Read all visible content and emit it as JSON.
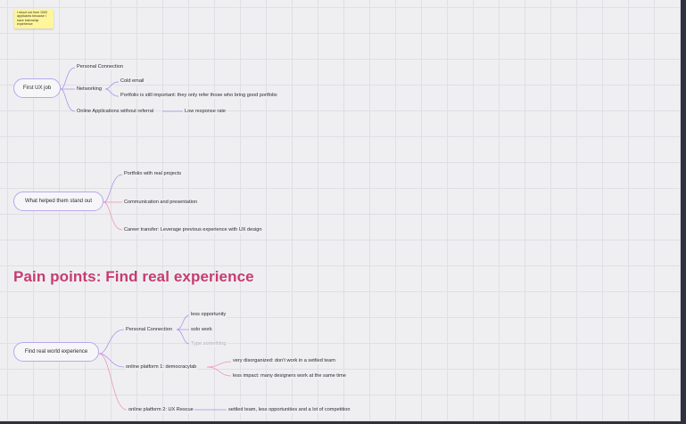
{
  "sticky_note": {
    "text": "I stood out from 1000 applicants because I have internship experience"
  },
  "section_title": "Pain points: Find real experience",
  "colors": {
    "canvas": "#efeff1",
    "grid": "#dfdfe4",
    "title_accent": "#c73c72",
    "connector_purple": "#a98be8",
    "connector_pink": "#ee8fb4",
    "sticky_yellow": "#fff59a"
  },
  "mindmaps": [
    {
      "root": "First UX job",
      "children": [
        {
          "label": "Personal Connection",
          "children": []
        },
        {
          "label": "Networking",
          "children": [
            {
              "label": "Cold email"
            },
            {
              "label": "Portfolio is still important: they only refer those who bring good portfolio"
            }
          ]
        },
        {
          "label": "Online Applications without referral",
          "children": [
            {
              "label": "Low response rate"
            }
          ]
        }
      ]
    },
    {
      "root": "What helped them stand out",
      "children": [
        {
          "label": "Portfolio with real projects"
        },
        {
          "label": "Communication and presentation"
        },
        {
          "label": "Career transfer: Leverage previous experience with UX design"
        }
      ]
    },
    {
      "root": "Find real world experience",
      "children": [
        {
          "label": "Personal Connection",
          "children": [
            {
              "label": "less opportunity"
            },
            {
              "label": "solo work"
            },
            {
              "label": "Type something"
            }
          ]
        },
        {
          "label": "online platform 1:  democracylab",
          "children": [
            {
              "label": "very disorganized: don't work in a settled team"
            },
            {
              "label": "less impact: many designers work at the same time"
            }
          ]
        },
        {
          "label": "online platform 2: UX Rescue",
          "children": [
            {
              "label": "settled team, less opportunities and a lot of competition"
            }
          ]
        }
      ]
    }
  ]
}
